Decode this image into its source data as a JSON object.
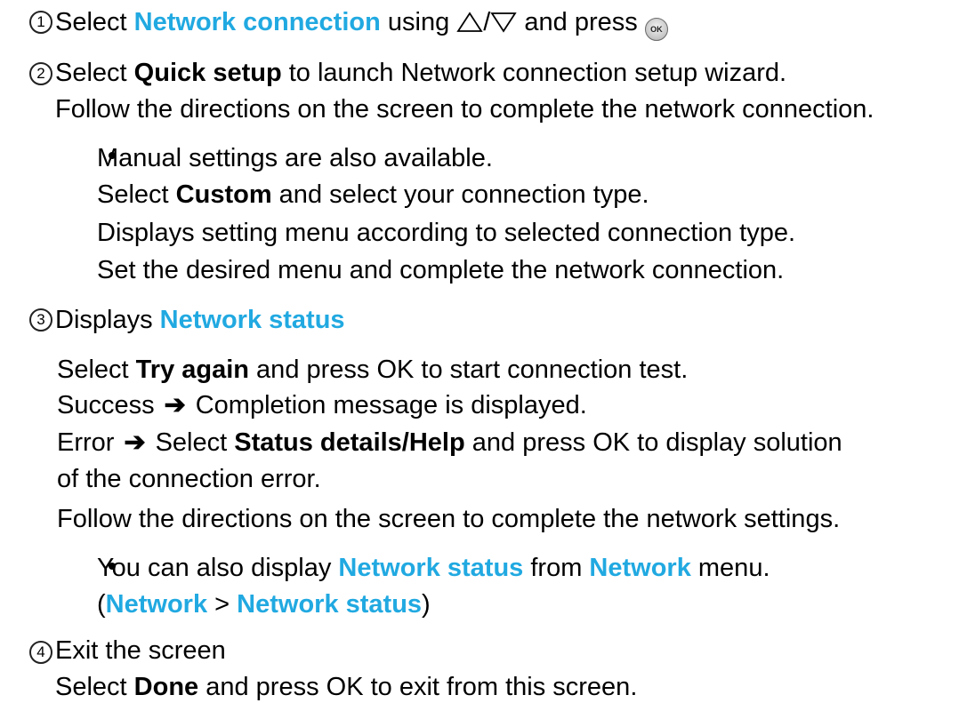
{
  "steps": [
    {
      "number": "1",
      "pre": "Select ",
      "highlight": "Network connection",
      "mid": " using ",
      "slash": "/",
      "post": " and press ",
      "ok_label": "OK",
      "icons": [
        "up-triangle-icon",
        "down-triangle-icon",
        "ok-button-icon"
      ]
    },
    {
      "number": "2",
      "pre": "Select ",
      "bold": "Quick setup",
      "post": " to launch Network connection setup wizard.",
      "line2": "Follow the directions on the screen to complete the network connection.",
      "note": {
        "line1": "Manual settings are also available.",
        "line2_pre": "Select ",
        "line2_bold": "Custom",
        "line2_post": " and select your connection type.",
        "line3": "Displays setting menu according to selected connection type.",
        "line4": "Set the desired menu and complete the network connection."
      }
    },
    {
      "number": "3",
      "pre": "Displays ",
      "highlight": "Network status",
      "try_pre": "Select ",
      "try_bold": "Try again",
      "try_post": " and press OK to start connection test.",
      "success_label": "Success",
      "success_text": "Completion message is displayed.",
      "error_label": "Error",
      "error_pre": "Select ",
      "error_bold": "Status details/Help",
      "error_post": " and press OK to display solution",
      "error_line2": "of the connection error.",
      "follow": "Follow the directions on the screen to complete the network settings.",
      "note": {
        "pre": "You can also display ",
        "hl1": "Network status",
        "mid": " from ",
        "hl2": "Network",
        "post": " menu.",
        "paren_open": "(",
        "path1": "Network",
        "sep": " > ",
        "path2": "Network status",
        "paren_close": ")"
      }
    },
    {
      "number": "4",
      "title": "Exit the screen",
      "pre": "Select ",
      "bold": "Done",
      "post": " and press OK to exit from this screen."
    }
  ],
  "arrow_glyph": "➔",
  "colors": {
    "highlight": "#21a9e1",
    "text": "#000000"
  }
}
